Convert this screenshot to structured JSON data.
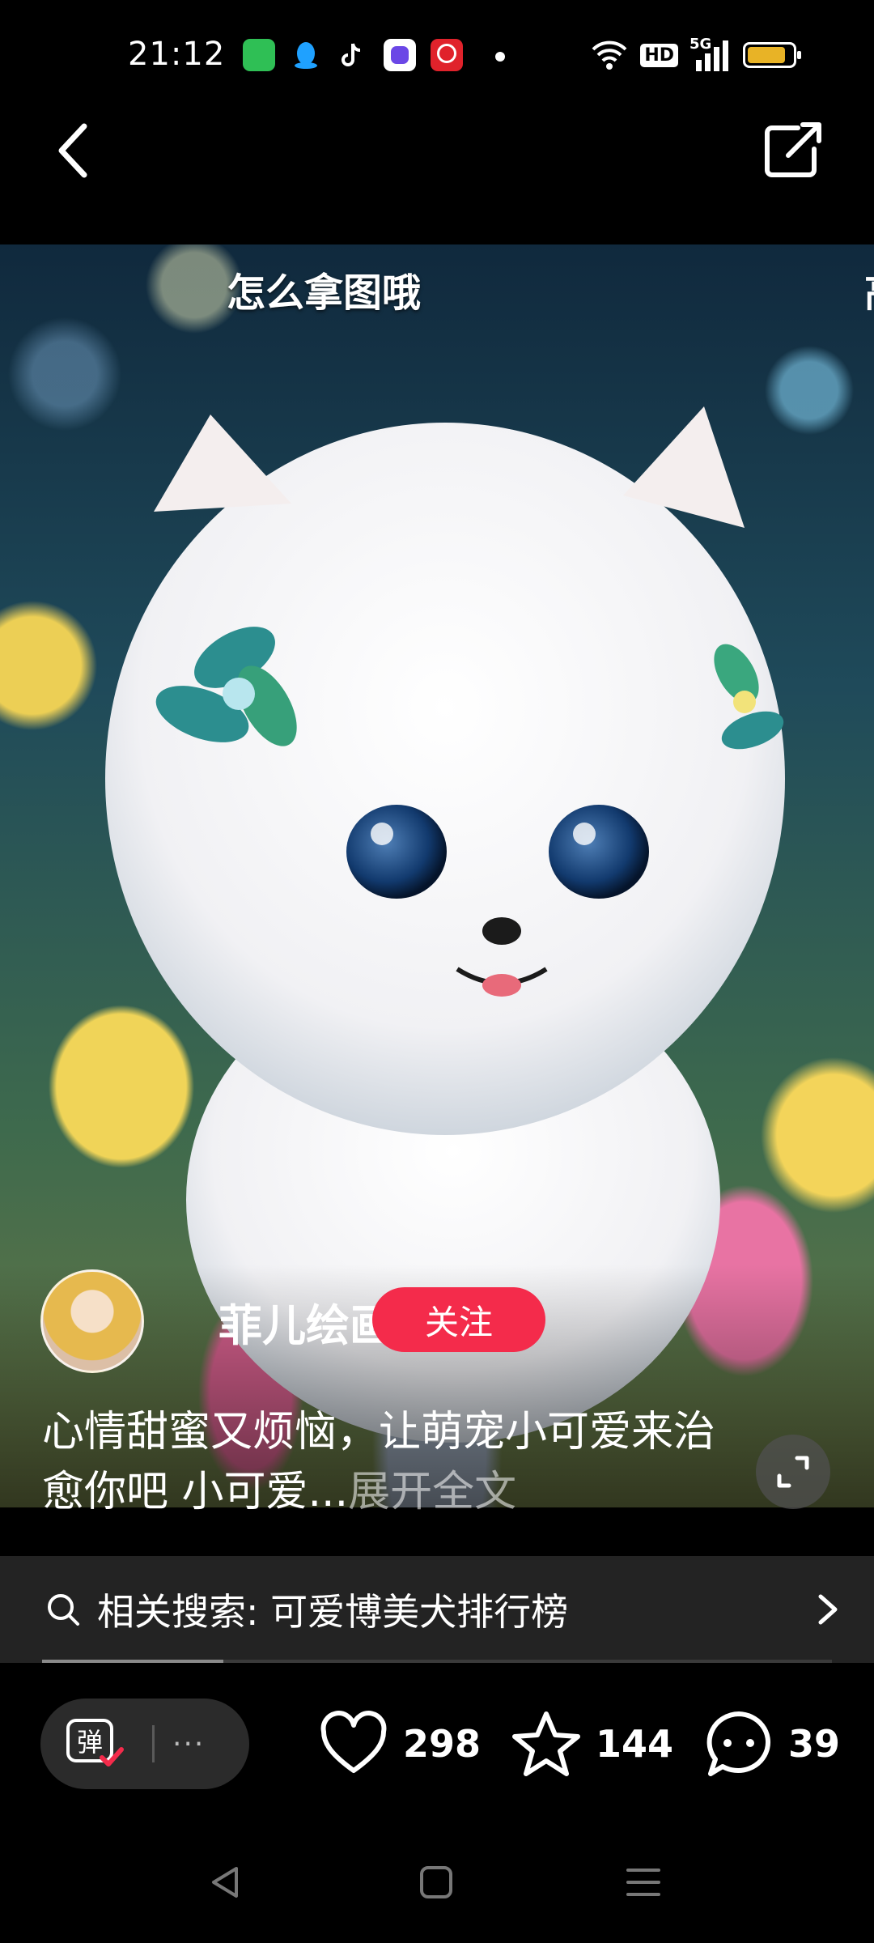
{
  "status_bar": {
    "time": "21:12",
    "notification_icons": [
      "wechat-like-app-icon",
      "qq-icon",
      "tiktok-icon",
      "message-app-icon",
      "bank-app-icon"
    ],
    "network": "5G",
    "hd_label": "HD",
    "battery_fill": 0.85,
    "battery_color": "#e8b326"
  },
  "post": {
    "overlay_title": "怎么拿图哦",
    "overlay_right_clip": "高",
    "author_name": "菲儿绘画",
    "follow_label": "关注",
    "description": "心情甜蜜又烦恼，让萌宠小可爱来治愈你吧 小可爱...",
    "expand_label": "展开全文"
  },
  "related": {
    "label": "相关搜索: 可爱博美犬排行榜",
    "scroll_progress": 0.23
  },
  "actions": {
    "danmaku_dots": "···",
    "likes": "298",
    "favorites": "144",
    "comments": "39"
  },
  "colors": {
    "follow": "#f42b4b",
    "panel": "#232323",
    "pill": "#2b2b2b"
  }
}
